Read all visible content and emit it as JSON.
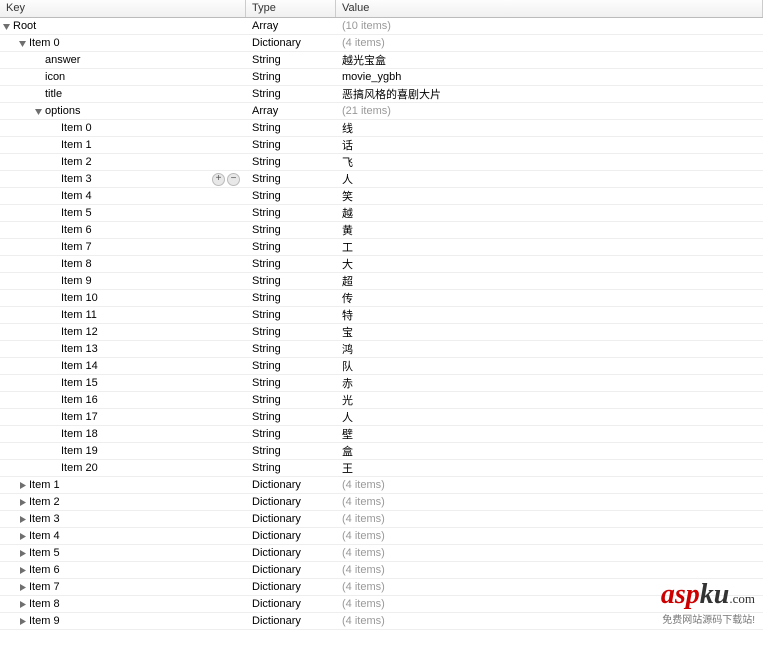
{
  "columns": {
    "key": "Key",
    "type": "Type",
    "value": "Value"
  },
  "rows": [
    {
      "indent": 0,
      "arrow": "down",
      "key": "Root",
      "type": "Array",
      "value": "(10 items)",
      "grey": true
    },
    {
      "indent": 1,
      "arrow": "down",
      "key": "Item 0",
      "type": "Dictionary",
      "value": "(4 items)",
      "grey": true
    },
    {
      "indent": 2,
      "arrow": "none",
      "key": "answer",
      "type": "String",
      "value": "越光宝盒"
    },
    {
      "indent": 2,
      "arrow": "none",
      "key": "icon",
      "type": "String",
      "value": "movie_ygbh"
    },
    {
      "indent": 2,
      "arrow": "none",
      "key": "title",
      "type": "String",
      "value": "恶搞风格的喜剧大片"
    },
    {
      "indent": 2,
      "arrow": "down",
      "key": "options",
      "type": "Array",
      "value": "(21 items)",
      "grey": true
    },
    {
      "indent": 3,
      "arrow": "none",
      "key": "Item 0",
      "type": "String",
      "value": "线"
    },
    {
      "indent": 3,
      "arrow": "none",
      "key": "Item 1",
      "type": "String",
      "value": "话"
    },
    {
      "indent": 3,
      "arrow": "none",
      "key": "Item 2",
      "type": "String",
      "value": "飞"
    },
    {
      "indent": 3,
      "arrow": "none",
      "key": "Item 3",
      "type": "String",
      "value": "人",
      "controls": true
    },
    {
      "indent": 3,
      "arrow": "none",
      "key": "Item 4",
      "type": "String",
      "value": "笑"
    },
    {
      "indent": 3,
      "arrow": "none",
      "key": "Item 5",
      "type": "String",
      "value": "越"
    },
    {
      "indent": 3,
      "arrow": "none",
      "key": "Item 6",
      "type": "String",
      "value": "黄"
    },
    {
      "indent": 3,
      "arrow": "none",
      "key": "Item 7",
      "type": "String",
      "value": "工"
    },
    {
      "indent": 3,
      "arrow": "none",
      "key": "Item 8",
      "type": "String",
      "value": "大"
    },
    {
      "indent": 3,
      "arrow": "none",
      "key": "Item 9",
      "type": "String",
      "value": "超"
    },
    {
      "indent": 3,
      "arrow": "none",
      "key": "Item 10",
      "type": "String",
      "value": "传"
    },
    {
      "indent": 3,
      "arrow": "none",
      "key": "Item 11",
      "type": "String",
      "value": "特"
    },
    {
      "indent": 3,
      "arrow": "none",
      "key": "Item 12",
      "type": "String",
      "value": "宝"
    },
    {
      "indent": 3,
      "arrow": "none",
      "key": "Item 13",
      "type": "String",
      "value": "鸿"
    },
    {
      "indent": 3,
      "arrow": "none",
      "key": "Item 14",
      "type": "String",
      "value": "队"
    },
    {
      "indent": 3,
      "arrow": "none",
      "key": "Item 15",
      "type": "String",
      "value": "赤"
    },
    {
      "indent": 3,
      "arrow": "none",
      "key": "Item 16",
      "type": "String",
      "value": "光"
    },
    {
      "indent": 3,
      "arrow": "none",
      "key": "Item 17",
      "type": "String",
      "value": "人"
    },
    {
      "indent": 3,
      "arrow": "none",
      "key": "Item 18",
      "type": "String",
      "value": "壁"
    },
    {
      "indent": 3,
      "arrow": "none",
      "key": "Item 19",
      "type": "String",
      "value": "盒"
    },
    {
      "indent": 3,
      "arrow": "none",
      "key": "Item 20",
      "type": "String",
      "value": "王"
    },
    {
      "indent": 1,
      "arrow": "right",
      "key": "Item 1",
      "type": "Dictionary",
      "value": "(4 items)",
      "grey": true
    },
    {
      "indent": 1,
      "arrow": "right",
      "key": "Item 2",
      "type": "Dictionary",
      "value": "(4 items)",
      "grey": true
    },
    {
      "indent": 1,
      "arrow": "right",
      "key": "Item 3",
      "type": "Dictionary",
      "value": "(4 items)",
      "grey": true
    },
    {
      "indent": 1,
      "arrow": "right",
      "key": "Item 4",
      "type": "Dictionary",
      "value": "(4 items)",
      "grey": true
    },
    {
      "indent": 1,
      "arrow": "right",
      "key": "Item 5",
      "type": "Dictionary",
      "value": "(4 items)",
      "grey": true
    },
    {
      "indent": 1,
      "arrow": "right",
      "key": "Item 6",
      "type": "Dictionary",
      "value": "(4 items)",
      "grey": true
    },
    {
      "indent": 1,
      "arrow": "right",
      "key": "Item 7",
      "type": "Dictionary",
      "value": "(4 items)",
      "grey": true
    },
    {
      "indent": 1,
      "arrow": "right",
      "key": "Item 8",
      "type": "Dictionary",
      "value": "(4 items)",
      "grey": true
    },
    {
      "indent": 1,
      "arrow": "right",
      "key": "Item 9",
      "type": "Dictionary",
      "value": "(4 items)",
      "grey": true
    }
  ],
  "watermark": {
    "brand": "aspku",
    "domain": ".com",
    "tagline": "免费网站源码下载站!"
  }
}
